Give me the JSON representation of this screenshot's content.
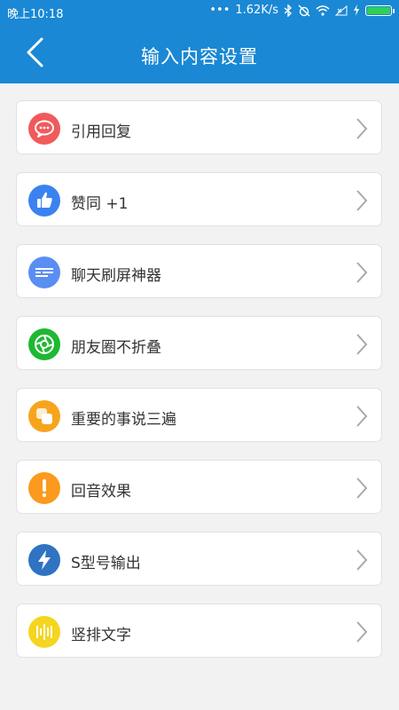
{
  "status_bar": {
    "time": "晚上10:18",
    "net_speed": "1.62K/s",
    "battery_color": "#2ed158"
  },
  "header": {
    "title": "输入内容设置",
    "back_icon": "chevron-left-icon",
    "background": "#1a88d4"
  },
  "settings": [
    {
      "label": "引用回复",
      "icon": "quote-bubble-icon",
      "color": "#f05a5a"
    },
    {
      "label": "赞同 +1",
      "icon": "thumbs-up-icon",
      "color": "#3b82f0"
    },
    {
      "label": "聊天刷屏神器",
      "icon": "chat-lines-icon",
      "color": "#5b8ef2"
    },
    {
      "label": "朋友圈不折叠",
      "icon": "aperture-icon",
      "color": "#1fb832"
    },
    {
      "label": "重要的事说三遍",
      "icon": "stacked-squares-icon",
      "color": "#f7a41d"
    },
    {
      "label": "回音效果",
      "icon": "exclamation-icon",
      "color": "#fb9a1d"
    },
    {
      "label": "S型号输出",
      "icon": "lightning-icon",
      "color": "#2f73c2"
    },
    {
      "label": "竖排文字",
      "icon": "vertical-bars-icon",
      "color": "#f4d620"
    }
  ]
}
